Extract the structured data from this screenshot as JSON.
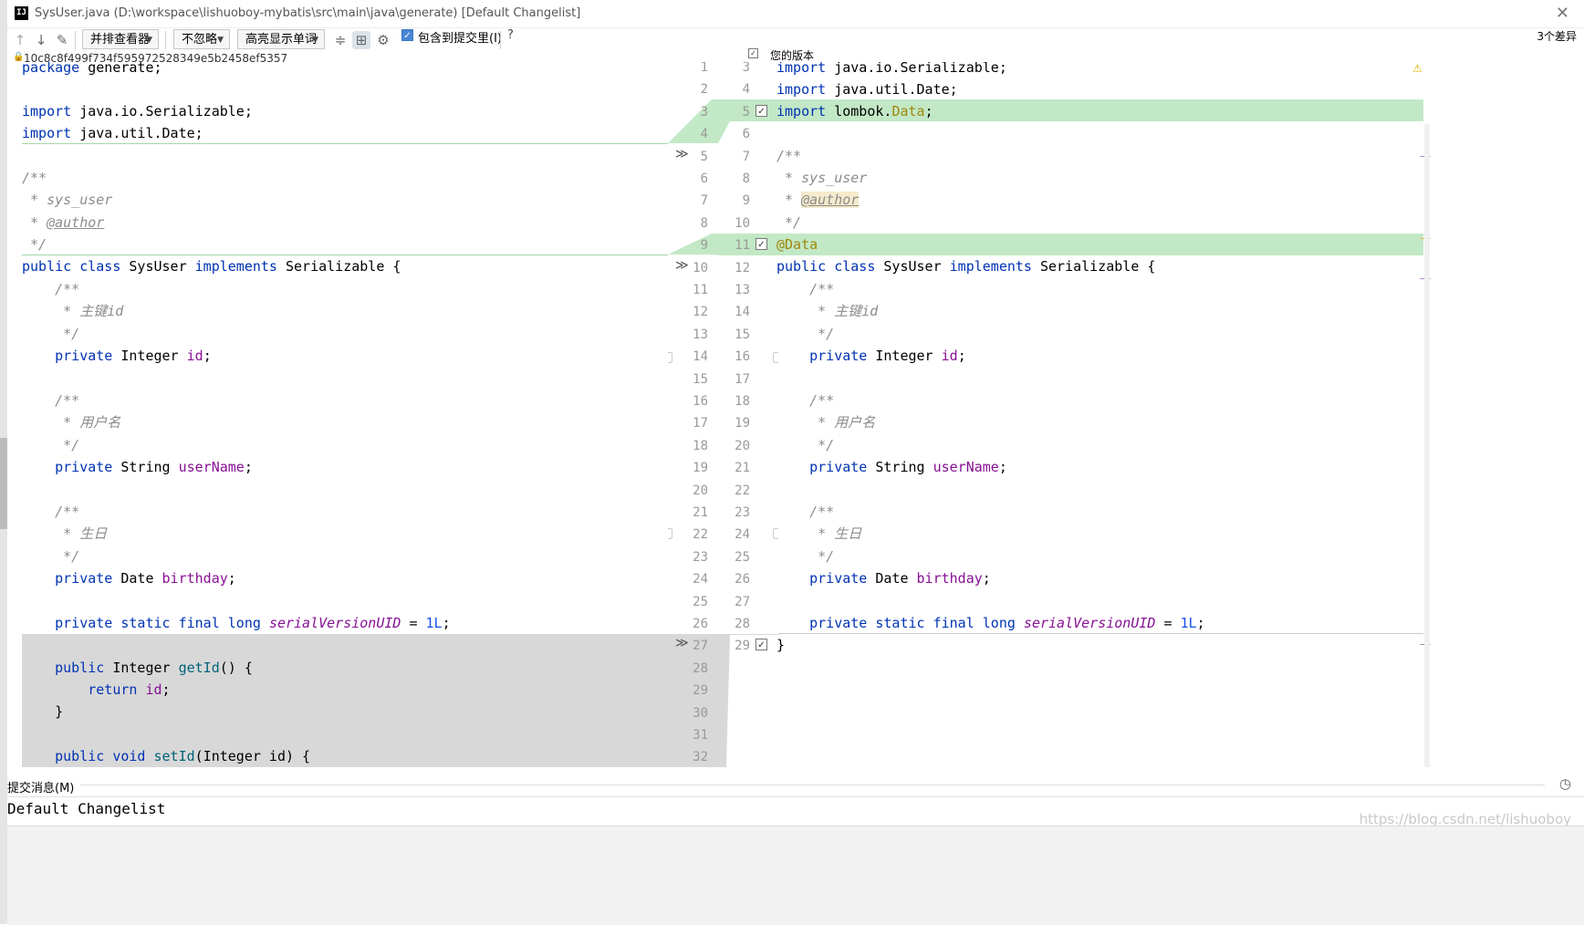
{
  "window": {
    "title": "SysUser.java (D:\\workspace\\lishuoboy-mybatis\\src\\main\\java\\generate) [Default Changelist]",
    "app_icon": "IJ"
  },
  "toolbar": {
    "viewer_label": "并排查看器",
    "ignore_label": "不忽略",
    "highlight_label": "高亮显示单词",
    "include_label": "包含到提交里(I)",
    "help_label": "?",
    "diff_count": "3个差异"
  },
  "revision": {
    "hash": "10c8c8f499f734f595972528349e5b2458ef5357",
    "yours_label": "您的版本"
  },
  "left_lines": [
    "package generate;",
    "",
    "import java.io.Serializable;",
    "import java.util.Date;",
    "",
    "/**",
    " * sys_user",
    " * @author",
    " */",
    "public class SysUser implements Serializable {",
    "    /**",
    "     * 主键id",
    "     */",
    "    private Integer id;",
    "",
    "    /**",
    "     * 用户名",
    "     */",
    "    private String userName;",
    "",
    "    /**",
    "     * 生日",
    "     */",
    "    private Date birthday;",
    "",
    "    private static final long serialVersionUID = 1L;",
    "",
    "    public Integer getId() {",
    "        return id;",
    "    }",
    "",
    "    public void setId(Integer id) {"
  ],
  "right_lines": [
    "import java.io.Serializable;",
    "import java.util.Date;",
    "import lombok.Data;",
    "",
    "/**",
    " * sys_user",
    " * @author",
    " */",
    "@Data",
    "public class SysUser implements Serializable {",
    "    /**",
    "     * 主键id",
    "     */",
    "    private Integer id;",
    "",
    "    /**",
    "     * 用户名",
    "     */",
    "    private String userName;",
    "",
    "    /**",
    "     * 生日",
    "     */",
    "    private Date birthday;",
    "",
    "    private static final long serialVersionUID = 1L;",
    "}"
  ],
  "left_numbers": [
    "1",
    "2",
    "3",
    "4",
    "5",
    "6",
    "7",
    "8",
    "9",
    "10",
    "11",
    "12",
    "13",
    "14",
    "15",
    "16",
    "17",
    "18",
    "19",
    "20",
    "21",
    "22",
    "23",
    "24",
    "25",
    "26",
    "27",
    "28",
    "29",
    "30",
    "31",
    "32"
  ],
  "right_numbers": [
    "3",
    "4",
    "5",
    "6",
    "7",
    "8",
    "9",
    "10",
    "11",
    "12",
    "13",
    "14",
    "15",
    "16",
    "17",
    "18",
    "19",
    "20",
    "21",
    "22",
    "23",
    "24",
    "25",
    "26",
    "27",
    "28",
    "29"
  ],
  "commit": {
    "label": "提交消息(M)",
    "message": "Default Changelist"
  },
  "watermark": "https://blog.csdn.net/lishuoboy",
  "colors": {
    "added_bg": "#c2e8c5",
    "deleted_bg": "#d8d8d8",
    "keyword": "#0033b3",
    "field": "#871094",
    "comment": "#8c8c8c"
  }
}
